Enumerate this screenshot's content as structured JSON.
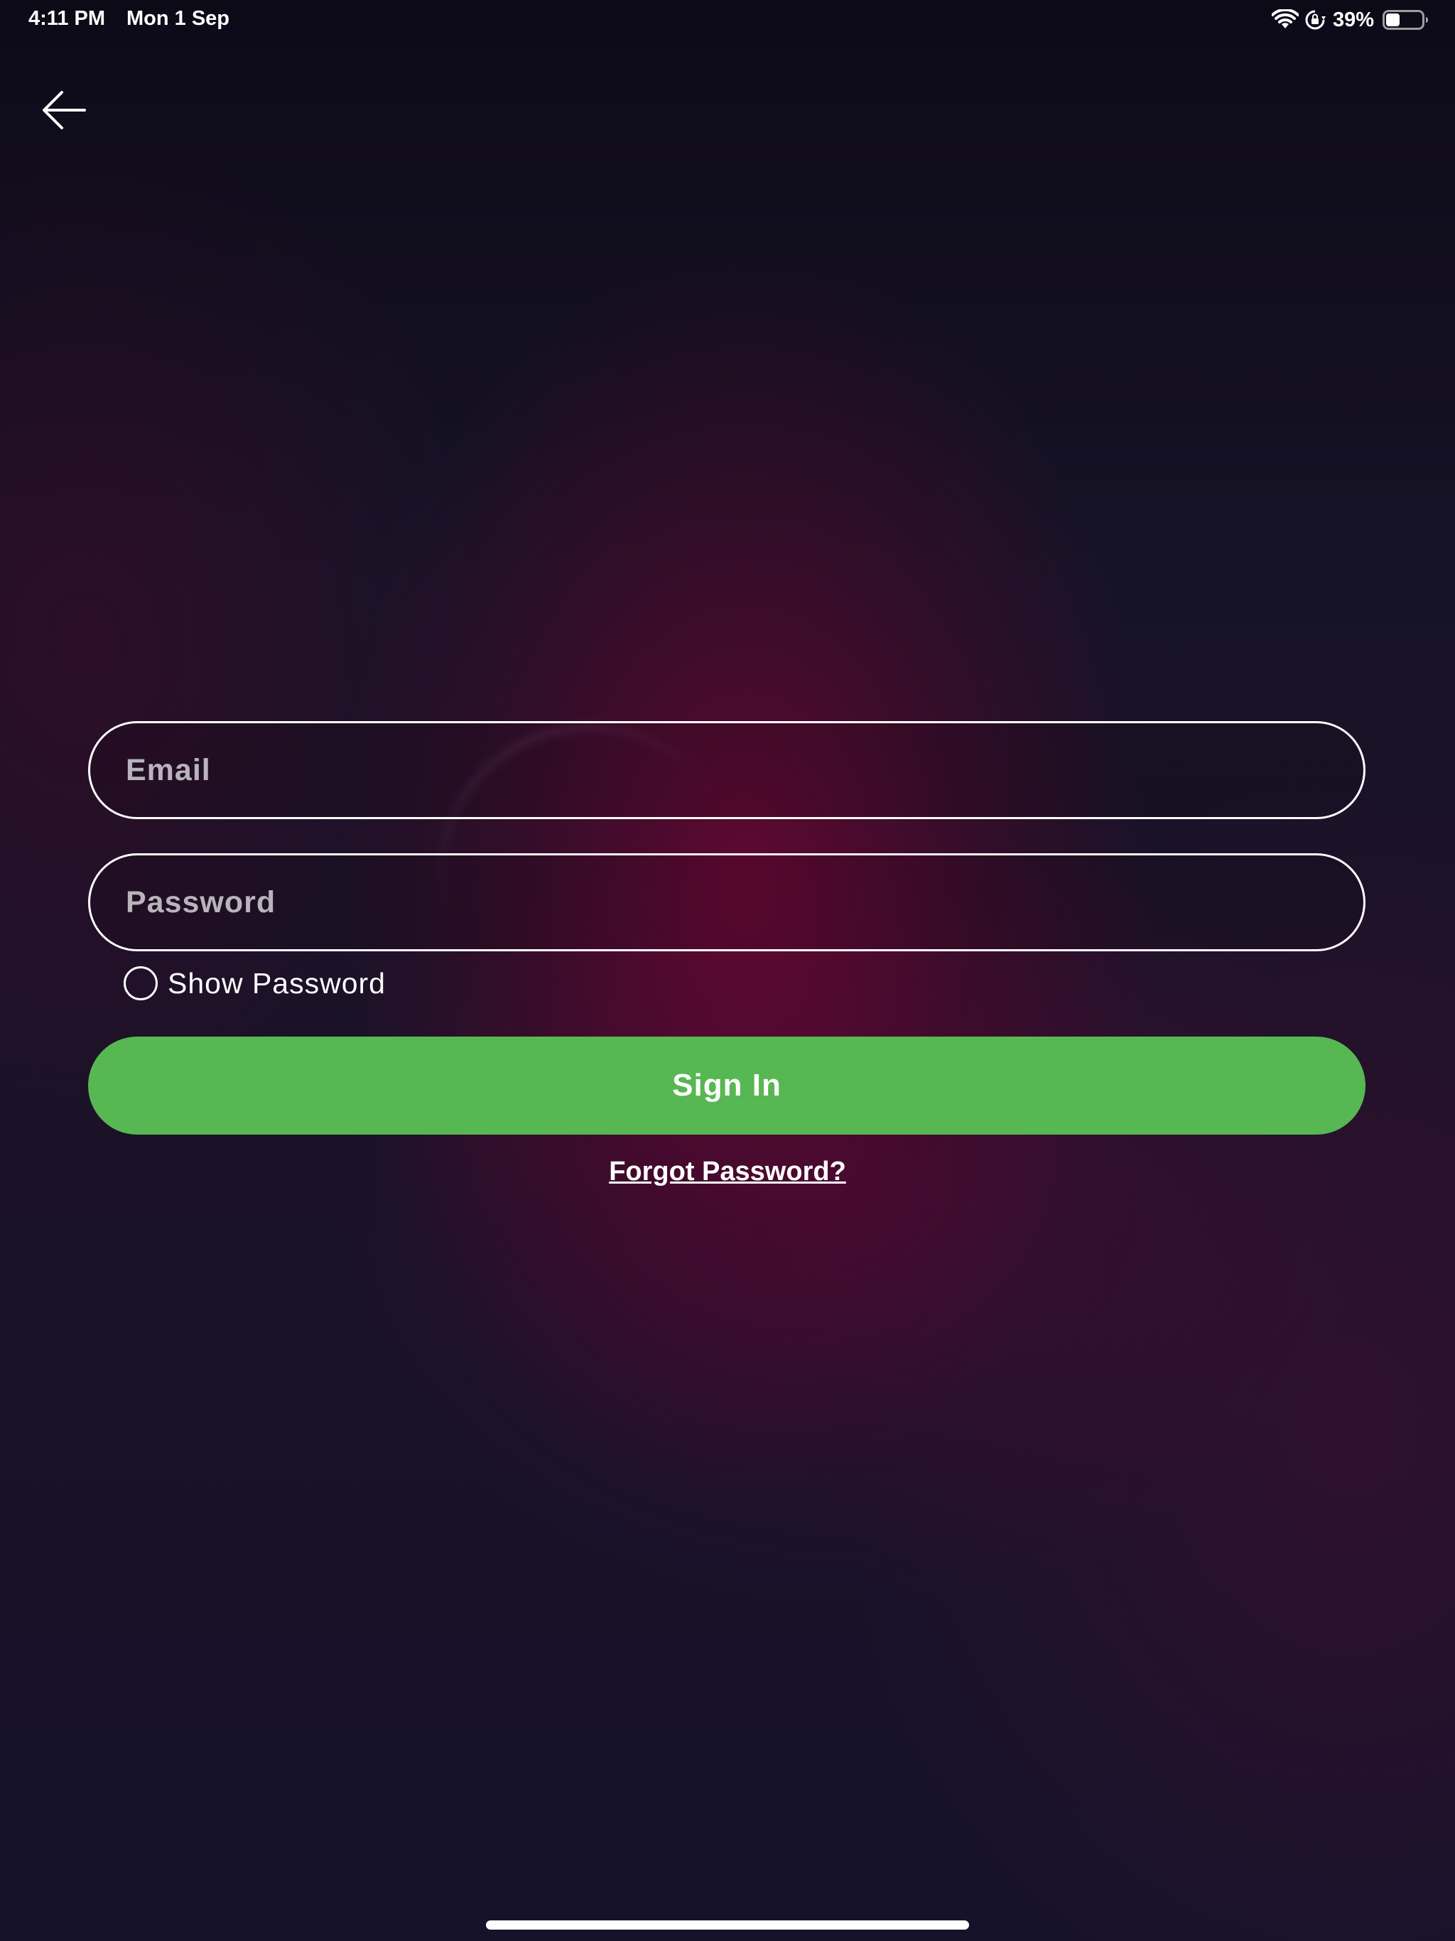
{
  "status_bar": {
    "time": "4:11 PM",
    "date": "Mon 1 Sep",
    "battery_percent": "39%",
    "battery_level": 0.39,
    "icons": [
      "wifi-icon",
      "orientation-lock-icon",
      "battery-icon"
    ]
  },
  "nav": {
    "back_icon": "arrow-left-icon"
  },
  "form": {
    "email_placeholder": "Email",
    "password_placeholder": "Password",
    "show_password_label": "Show Password",
    "show_password_checked": false,
    "sign_in_label": "Sign In",
    "forgot_password_label": "Forgot Password?"
  },
  "colors": {
    "primary_button": "#57b752",
    "background": "#161126",
    "accent_glow": "#960037"
  }
}
